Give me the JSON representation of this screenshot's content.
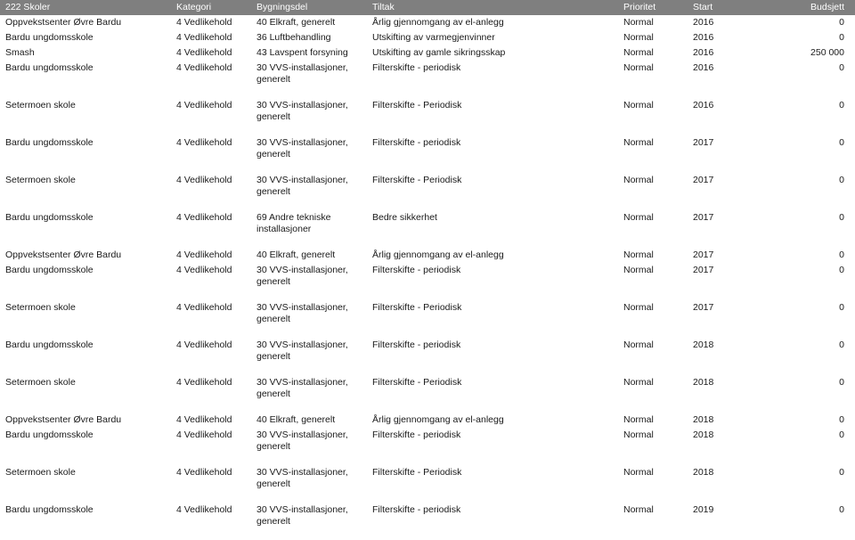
{
  "header": {
    "accent_color": "#7f7f7f",
    "text_color": "#ffffff",
    "columns": [
      {
        "key": "skole",
        "label": "222 Skoler"
      },
      {
        "key": "kategori",
        "label": "Kategori"
      },
      {
        "key": "bygningsdel",
        "label": "Bygningsdel"
      },
      {
        "key": "tiltak",
        "label": "Tiltak"
      },
      {
        "key": "prioritet",
        "label": "Prioritet"
      },
      {
        "key": "start",
        "label": "Start"
      },
      {
        "key": "budsjett",
        "label": "Budsjett"
      }
    ]
  },
  "rows": [
    {
      "skole": "Oppvekstsenter Øvre Bardu",
      "kategori": "4 Vedlikehold",
      "bygningsdel": "40 Elkraft, generelt",
      "bygningsdel_line2": "",
      "tiltak": "Årlig gjennomgang av el-anlegg",
      "prioritet": "Normal",
      "start": "2016",
      "budsjett": "0"
    },
    {
      "skole": "Bardu ungdomsskole",
      "kategori": "4 Vedlikehold",
      "bygningsdel": "36 Luftbehandling",
      "bygningsdel_line2": "",
      "tiltak": "Utskifting av varmegjenvinner",
      "prioritet": "Normal",
      "start": "2016",
      "budsjett": "0"
    },
    {
      "skole": "Smash",
      "kategori": "4 Vedlikehold",
      "bygningsdel": "43 Lavspent forsyning",
      "bygningsdel_line2": "",
      "tiltak": "Utskifting av gamle sikringsskap",
      "prioritet": "Normal",
      "start": "2016",
      "budsjett": "250 000"
    },
    {
      "skole": "Bardu ungdomsskole",
      "kategori": "4 Vedlikehold",
      "bygningsdel": "30 VVS-installasjoner,",
      "bygningsdel_line2": "generelt",
      "tiltak": "Filterskifte - periodisk",
      "prioritet": "Normal",
      "start": "2016",
      "budsjett": "0"
    },
    {
      "skole": "Setermoen skole",
      "kategori": "4 Vedlikehold",
      "bygningsdel": "30 VVS-installasjoner,",
      "bygningsdel_line2": "generelt",
      "tiltak": "Filterskifte - Periodisk",
      "prioritet": "Normal",
      "start": "2016",
      "budsjett": "0"
    },
    {
      "skole": "Bardu ungdomsskole",
      "kategori": "4 Vedlikehold",
      "bygningsdel": "30 VVS-installasjoner,",
      "bygningsdel_line2": "generelt",
      "tiltak": "Filterskifte - periodisk",
      "prioritet": "Normal",
      "start": "2017",
      "budsjett": "0"
    },
    {
      "skole": "Setermoen skole",
      "kategori": "4 Vedlikehold",
      "bygningsdel": "30 VVS-installasjoner,",
      "bygningsdel_line2": "generelt",
      "tiltak": "Filterskifte - Periodisk",
      "prioritet": "Normal",
      "start": "2017",
      "budsjett": "0"
    },
    {
      "skole": "Bardu ungdomsskole",
      "kategori": "4 Vedlikehold",
      "bygningsdel": "69 Andre tekniske",
      "bygningsdel_line2": "installasjoner",
      "tiltak": "Bedre sikkerhet",
      "prioritet": "Normal",
      "start": "2017",
      "budsjett": "0"
    },
    {
      "skole": "Oppvekstsenter Øvre Bardu",
      "kategori": "4 Vedlikehold",
      "bygningsdel": "40 Elkraft, generelt",
      "bygningsdel_line2": "",
      "tiltak": "Årlig gjennomgang av el-anlegg",
      "prioritet": "Normal",
      "start": "2017",
      "budsjett": "0"
    },
    {
      "skole": "Bardu ungdomsskole",
      "kategori": "4 Vedlikehold",
      "bygningsdel": "30 VVS-installasjoner,",
      "bygningsdel_line2": "generelt",
      "tiltak": "Filterskifte - periodisk",
      "prioritet": "Normal",
      "start": "2017",
      "budsjett": "0"
    },
    {
      "skole": "Setermoen skole",
      "kategori": "4 Vedlikehold",
      "bygningsdel": "30 VVS-installasjoner,",
      "bygningsdel_line2": "generelt",
      "tiltak": "Filterskifte - Periodisk",
      "prioritet": "Normal",
      "start": "2017",
      "budsjett": "0"
    },
    {
      "skole": "Bardu ungdomsskole",
      "kategori": "4 Vedlikehold",
      "bygningsdel": "30 VVS-installasjoner,",
      "bygningsdel_line2": "generelt",
      "tiltak": "Filterskifte - periodisk",
      "prioritet": "Normal",
      "start": "2018",
      "budsjett": "0"
    },
    {
      "skole": "Setermoen skole",
      "kategori": "4 Vedlikehold",
      "bygningsdel": "30 VVS-installasjoner,",
      "bygningsdel_line2": "generelt",
      "tiltak": "Filterskifte - Periodisk",
      "prioritet": "Normal",
      "start": "2018",
      "budsjett": "0"
    },
    {
      "skole": "Oppvekstsenter Øvre Bardu",
      "kategori": "4 Vedlikehold",
      "bygningsdel": "40 Elkraft, generelt",
      "bygningsdel_line2": "",
      "tiltak": "Årlig gjennomgang av el-anlegg",
      "prioritet": "Normal",
      "start": "2018",
      "budsjett": "0"
    },
    {
      "skole": "Bardu ungdomsskole",
      "kategori": "4 Vedlikehold",
      "bygningsdel": "30 VVS-installasjoner,",
      "bygningsdel_line2": "generelt",
      "tiltak": "Filterskifte - periodisk",
      "prioritet": "Normal",
      "start": "2018",
      "budsjett": "0"
    },
    {
      "skole": "Setermoen skole",
      "kategori": "4 Vedlikehold",
      "bygningsdel": "30 VVS-installasjoner,",
      "bygningsdel_line2": "generelt",
      "tiltak": "Filterskifte - Periodisk",
      "prioritet": "Normal",
      "start": "2018",
      "budsjett": "0"
    },
    {
      "skole": "Bardu ungdomsskole",
      "kategori": "4 Vedlikehold",
      "bygningsdel": "30 VVS-installasjoner,",
      "bygningsdel_line2": "generelt",
      "tiltak": "Filterskifte - periodisk",
      "prioritet": "Normal",
      "start": "2019",
      "budsjett": "0"
    }
  ]
}
